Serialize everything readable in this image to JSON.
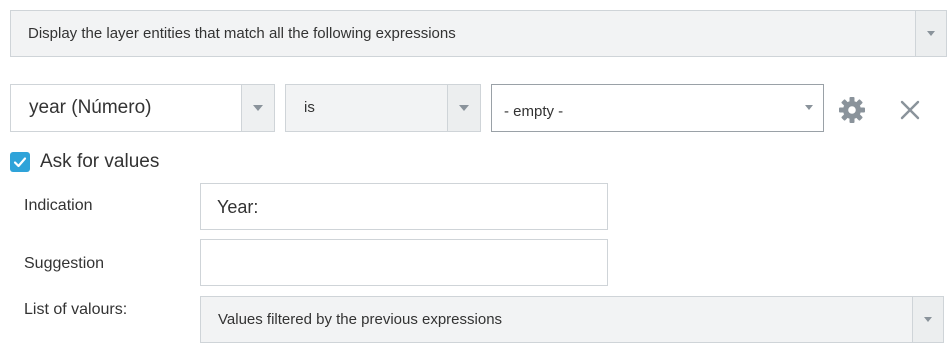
{
  "match_mode": {
    "value": "Display the layer entities that match all the following expressions"
  },
  "expression": {
    "field": "year (Número)",
    "operator": "is",
    "value": "- empty -",
    "settings_icon": "gear-icon",
    "remove_icon": "close-icon"
  },
  "ask_for_values": {
    "checked": true,
    "label": "Ask for values"
  },
  "indication": {
    "label": "Indication",
    "value": "Year:"
  },
  "suggestion": {
    "label": "Suggestion",
    "value": ""
  },
  "list_of_values": {
    "label": "List of valours:",
    "value": "Values filtered by the previous expressions"
  },
  "colors": {
    "checkbox": "#2fa3d9",
    "border": "#cfd4d8",
    "select_bg": "#f2f3f4",
    "icon": "#8a939b"
  }
}
